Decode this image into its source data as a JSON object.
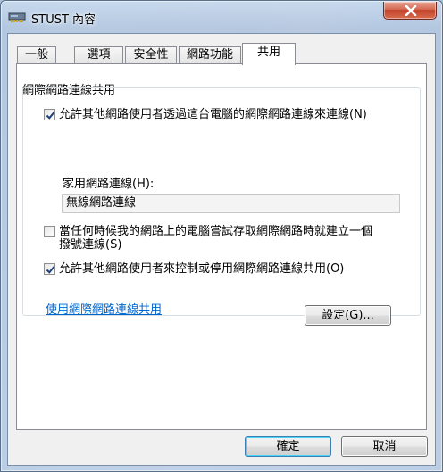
{
  "window": {
    "title": "STUST 內容"
  },
  "tabs": [
    {
      "label": "一般"
    },
    {
      "label": "選項"
    },
    {
      "label": "安全性"
    },
    {
      "label": "網路功能"
    },
    {
      "label": "共用"
    }
  ],
  "active_tab": "共用",
  "group": {
    "title": "網際網路連線共用",
    "allow_share": {
      "checked": true,
      "label": "允許其他網路使用者透過這台電腦的網際網路連線來連線(N)"
    },
    "home_connection": {
      "label": "家用網路連線(H):",
      "value": "無線網路連線"
    },
    "dial_on_demand": {
      "checked": false,
      "label": "當任何時候我的網路上的電腦嘗試存取網際網路時就建立一個撥號連線(S)"
    },
    "allow_control": {
      "checked": true,
      "label": "允許其他網路使用者來控制或停用網際網路連線共用(O)"
    },
    "link": "使用網際網路連線共用",
    "settings_button": "設定(G)..."
  },
  "footer": {
    "ok": "確定",
    "cancel": "取消"
  },
  "icons": {
    "title": "network-adapter-icon",
    "close": "close-icon",
    "check": "check-icon"
  }
}
